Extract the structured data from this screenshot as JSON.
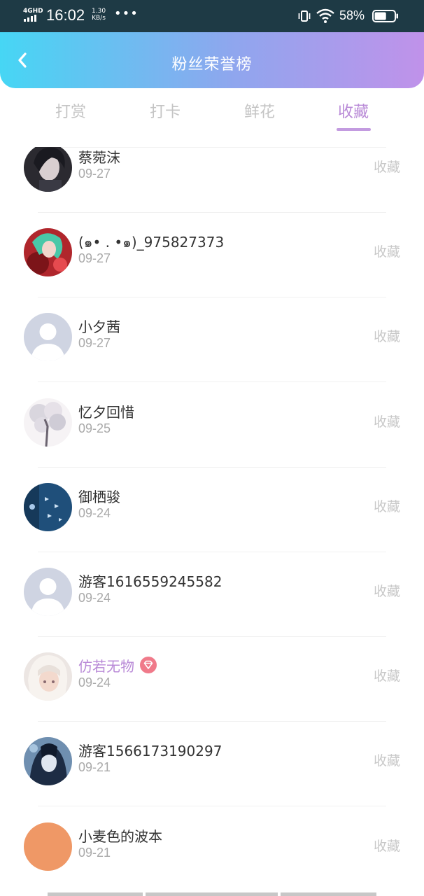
{
  "status_bar": {
    "network": "4GHD",
    "time": "16:02",
    "speed_value": "1.30",
    "speed_unit": "KB/s",
    "more": "•••",
    "battery_percent": "58%",
    "battery_level": 0.58
  },
  "header": {
    "back_icon": "chevron-left-icon",
    "title": "粉丝荣誉榜",
    "gradient": [
      "#46d6f4",
      "#8fa6ee",
      "#c092ea"
    ]
  },
  "tabs": [
    {
      "label": "打赏",
      "active": false
    },
    {
      "label": "打卡",
      "active": false
    },
    {
      "label": "鲜花",
      "active": false
    },
    {
      "label": "收藏",
      "active": true
    }
  ],
  "accent_color": "#b98ad7",
  "fans": [
    {
      "name": "蔡菀沫",
      "date": "09-27",
      "action": "收藏",
      "avatar": "dark-portrait"
    },
    {
      "name": "(๑• . •๑)_975827373",
      "date": "09-27",
      "action": "收藏",
      "avatar": "anime-green-hair"
    },
    {
      "name": "小夕茜",
      "date": "09-27",
      "action": "收藏",
      "avatar": "default-silhouette"
    },
    {
      "name": "忆夕回惜",
      "date": "09-25",
      "action": "收藏",
      "avatar": "blossom-tree"
    },
    {
      "name": "御栖骏",
      "date": "09-24",
      "action": "收藏",
      "avatar": "blue-butterflies"
    },
    {
      "name": "游客1616559245582",
      "date": "09-24",
      "action": "收藏",
      "avatar": "default-silhouette"
    },
    {
      "name": "仿若无物",
      "date": "09-24",
      "action": "收藏",
      "avatar": "anime-white-hair",
      "vip": true,
      "badge_icon": "diamond-icon"
    },
    {
      "name": "游客1566173190297",
      "date": "09-21",
      "action": "收藏",
      "avatar": "anime-dark-blue"
    },
    {
      "name": "小麦色的波本",
      "date": "09-21",
      "action": "收藏",
      "avatar": "orange-solid"
    }
  ]
}
